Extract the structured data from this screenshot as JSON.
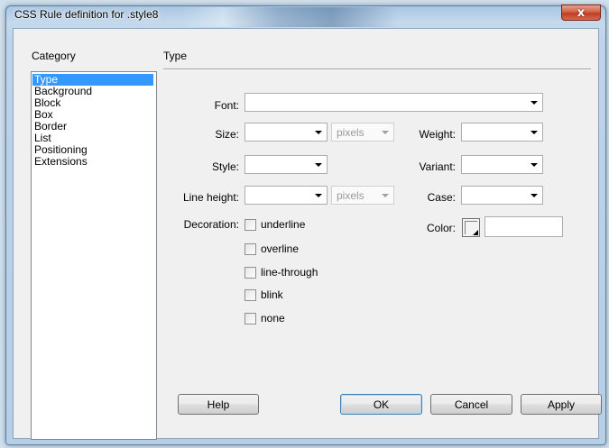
{
  "window": {
    "title": "CSS Rule definition for .style8",
    "close_glyph": "x"
  },
  "category": {
    "heading": "Category",
    "items": [
      "Type",
      "Background",
      "Block",
      "Box",
      "Border",
      "List",
      "Positioning",
      "Extensions"
    ],
    "selected": "Type"
  },
  "panel": {
    "heading": "Type",
    "font": {
      "label": "Font:",
      "value": ""
    },
    "size": {
      "label": "Size:",
      "value": "",
      "unit": "pixels"
    },
    "weight": {
      "label": "Weight:",
      "value": ""
    },
    "style": {
      "label": "Style:",
      "value": ""
    },
    "variant": {
      "label": "Variant:",
      "value": ""
    },
    "line_height": {
      "label": "Line height:",
      "value": "",
      "unit": "pixels"
    },
    "case": {
      "label": "Case:",
      "value": ""
    },
    "decoration": {
      "label": "Decoration:",
      "options": [
        {
          "label": "underline",
          "checked": false
        },
        {
          "label": "overline",
          "checked": false
        },
        {
          "label": "line-through",
          "checked": false
        },
        {
          "label": "blink",
          "checked": false
        },
        {
          "label": "none",
          "checked": false
        }
      ]
    },
    "color": {
      "label": "Color:",
      "value": ""
    }
  },
  "buttons": {
    "help": "Help",
    "ok": "OK",
    "cancel": "Cancel",
    "apply": "Apply"
  },
  "colors": {
    "selection": "#3399ff",
    "close_button": "#c33c22"
  }
}
